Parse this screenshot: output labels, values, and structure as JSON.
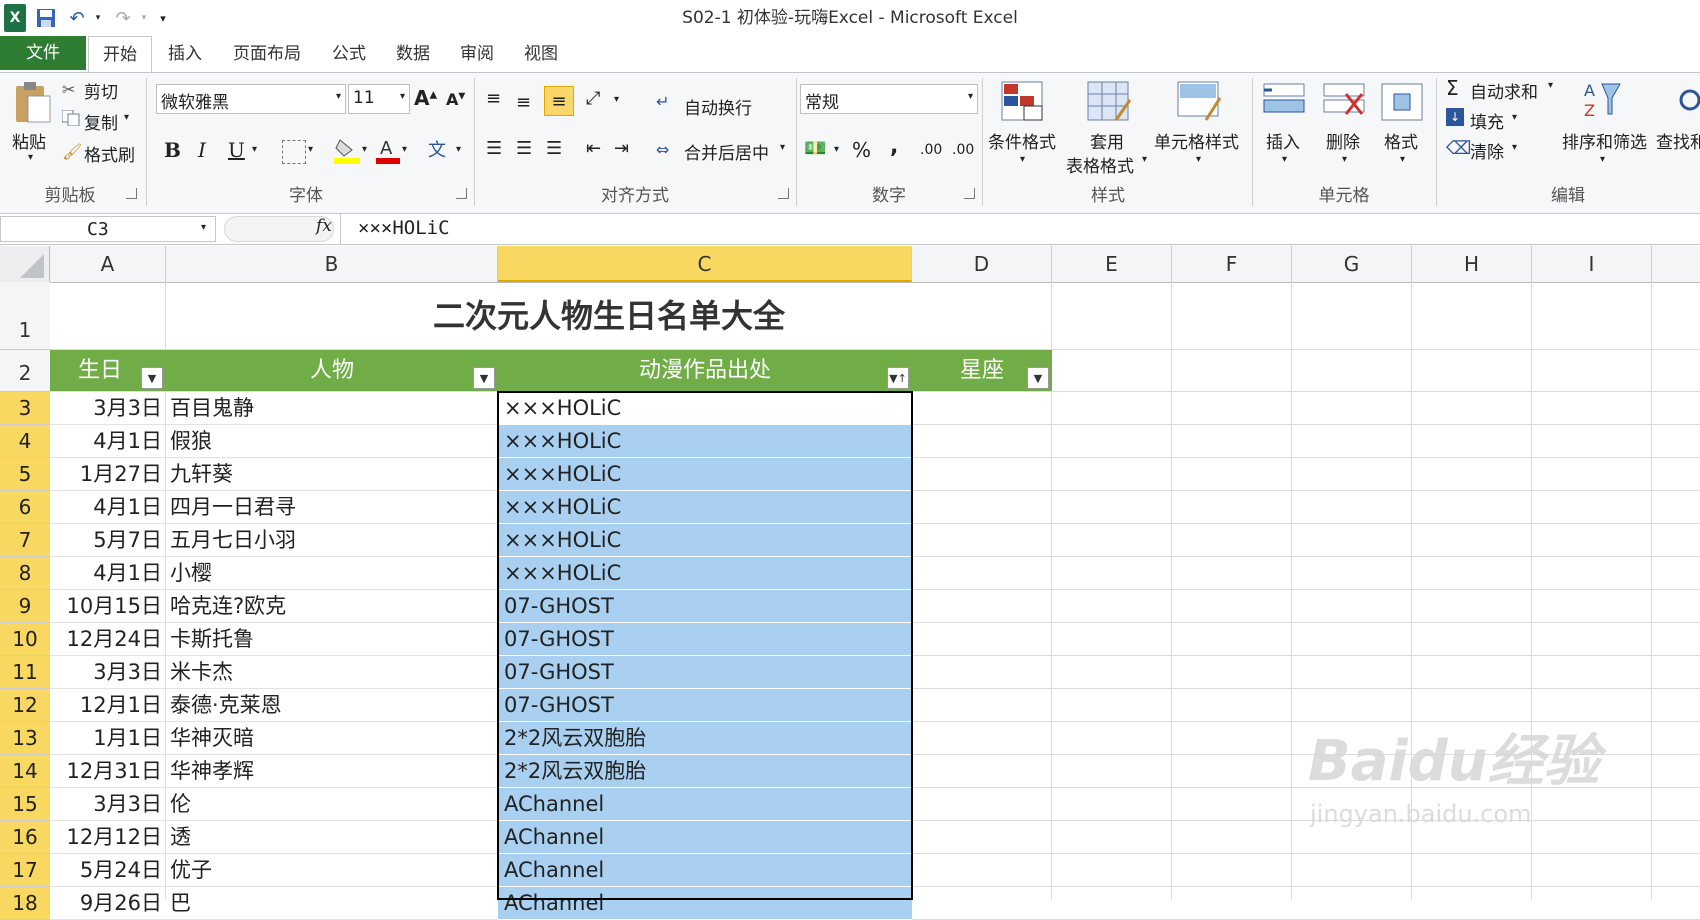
{
  "window": {
    "title": "S02-1 初体验-玩嗨Excel - Microsoft Excel"
  },
  "tabs": [
    "文件",
    "开始",
    "插入",
    "页面布局",
    "公式",
    "数据",
    "审阅",
    "视图"
  ],
  "ribbon": {
    "clipboard": {
      "paste": "粘贴",
      "cut": "剪切",
      "copy": "复制",
      "format_painter": "格式刷",
      "label": "剪贴板"
    },
    "font": {
      "name": "微软雅黑",
      "size": "11",
      "bold": "B",
      "italic": "I",
      "underline": "U",
      "label": "字体"
    },
    "alignment": {
      "wrap": "自动换行",
      "merge": "合并后居中",
      "label": "对齐方式"
    },
    "number": {
      "format": "常规",
      "percent": "%",
      "comma": ",",
      "label": "数字"
    },
    "styles": {
      "conditional": "条件格式",
      "table_fmt_1": "套用",
      "table_fmt_2": "表格格式",
      "cell_styles": "单元格样式",
      "label": "样式"
    },
    "cells": {
      "insert": "插入",
      "delete": "删除",
      "format": "格式",
      "label": "单元格"
    },
    "editing": {
      "autosum": "自动求和",
      "fill": "填充",
      "clear": "清除",
      "sort_filter": "排序和筛选",
      "find": "查找和",
      "label": "编辑"
    }
  },
  "formula_bar": {
    "name_box": "C3",
    "fx": "fx",
    "content": "×××HOLiC"
  },
  "columns": [
    "A",
    "B",
    "C",
    "D",
    "E",
    "F",
    "G",
    "H",
    "I"
  ],
  "sheet": {
    "title": "二次元人物生日名单大全",
    "headers": [
      "生日",
      "人物",
      "动漫作品出处",
      "星座"
    ],
    "rows": [
      {
        "n": "3",
        "a": "3月3日",
        "b": "百目鬼静",
        "c": "×××HOLiC"
      },
      {
        "n": "4",
        "a": "4月1日",
        "b": "假狼",
        "c": "×××HOLiC"
      },
      {
        "n": "5",
        "a": "1月27日",
        "b": "九轩葵",
        "c": "×××HOLiC"
      },
      {
        "n": "6",
        "a": "4月1日",
        "b": "四月一日君寻",
        "c": "×××HOLiC"
      },
      {
        "n": "7",
        "a": "5月7日",
        "b": "五月七日小羽",
        "c": "×××HOLiC"
      },
      {
        "n": "8",
        "a": "4月1日",
        "b": "小樱",
        "c": "×××HOLiC"
      },
      {
        "n": "9",
        "a": "10月15日",
        "b": "哈克连?欧克",
        "c": "07-GHOST"
      },
      {
        "n": "10",
        "a": "12月24日",
        "b": "卡斯托鲁",
        "c": "07-GHOST"
      },
      {
        "n": "11",
        "a": "3月3日",
        "b": "米卡杰",
        "c": "07-GHOST"
      },
      {
        "n": "12",
        "a": "12月1日",
        "b": "泰德·克莱恩",
        "c": "07-GHOST"
      },
      {
        "n": "13",
        "a": "1月1日",
        "b": "华神灭暗",
        "c": "2*2风云双胞胎"
      },
      {
        "n": "14",
        "a": "12月31日",
        "b": "华神孝辉",
        "c": "2*2风云双胞胎"
      },
      {
        "n": "15",
        "a": "3月3日",
        "b": "伦",
        "c": "AChannel"
      },
      {
        "n": "16",
        "a": "12月12日",
        "b": "透",
        "c": "AChannel"
      },
      {
        "n": "17",
        "a": "5月24日",
        "b": "优子",
        "c": "AChannel"
      },
      {
        "n": "18",
        "a": "9月26日",
        "b": "巴",
        "c": "AChannel"
      }
    ]
  },
  "watermark": {
    "brand": "Baidu经验",
    "url": "jingyan.baidu.com"
  },
  "colors": {
    "header_green": "#70ad47",
    "file_tab": "#2e7d32",
    "selection": "#a9d0f0",
    "row_highlight": "#f8d860"
  }
}
